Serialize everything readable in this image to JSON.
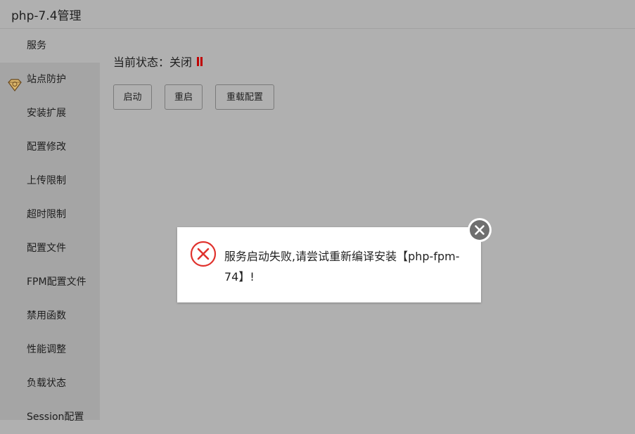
{
  "window": {
    "title": "php-7.4管理"
  },
  "sidebar": {
    "items": [
      {
        "label": "服务",
        "active": true
      },
      {
        "label": "站点防护",
        "icon": "shield-badge-icon"
      },
      {
        "label": "安装扩展"
      },
      {
        "label": "配置修改"
      },
      {
        "label": "上传限制"
      },
      {
        "label": "超时限制"
      },
      {
        "label": "配置文件"
      },
      {
        "label": "FPM配置文件"
      },
      {
        "label": "禁用函数"
      },
      {
        "label": "性能调整"
      },
      {
        "label": "负载状态"
      },
      {
        "label": "Session配置"
      }
    ]
  },
  "main": {
    "status_label": "当前状态：",
    "status_value": "关闭",
    "status_icon": "pause-icon",
    "status_color": "#c00000",
    "buttons": {
      "start": "启动",
      "restart": "重启",
      "reload": "重载配置"
    }
  },
  "dialog": {
    "message": "服务启动失败,请尝试重新编译安装【php-fpm-74】!",
    "icon": "error-circle-icon",
    "close_icon": "close-icon",
    "error_color": "#e0322d"
  }
}
